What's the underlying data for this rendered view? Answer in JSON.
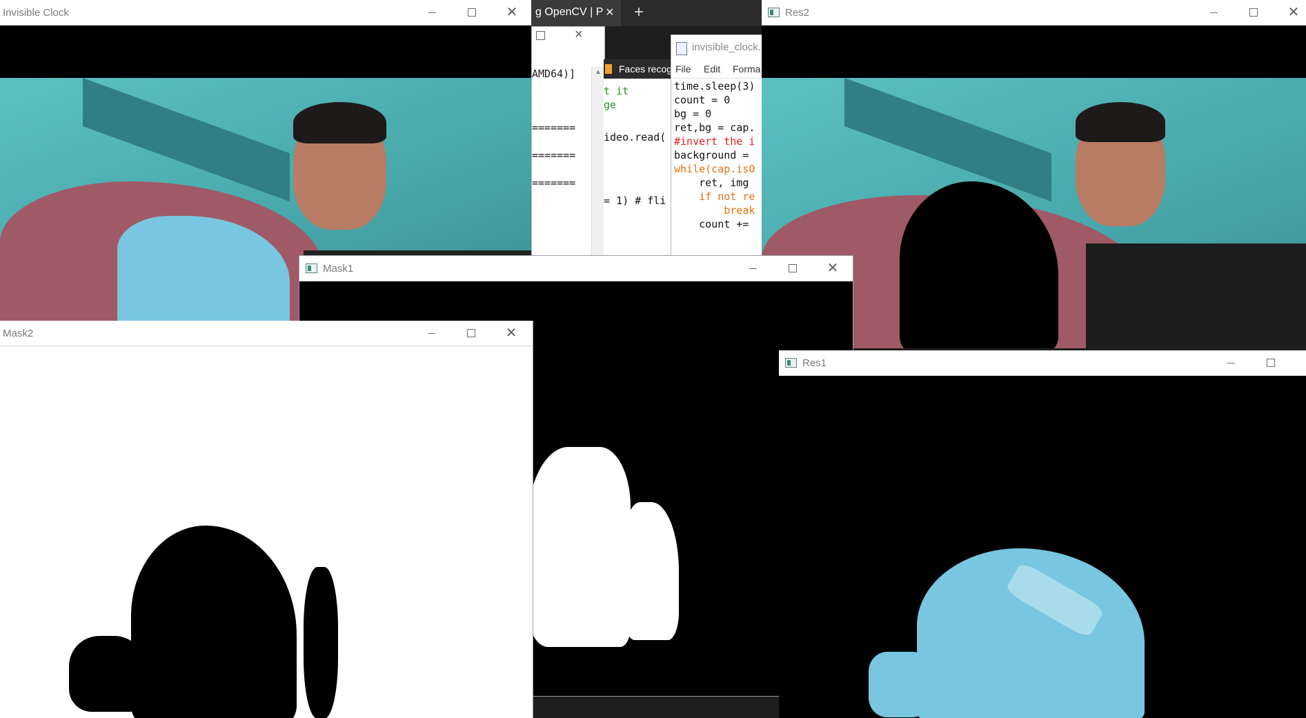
{
  "desktop": {
    "browser_tab_title": "g OpenCV | P",
    "browser_tab_close": "×",
    "browser_new_tab": "+",
    "bookmark_label": "Faces recog",
    "console_header": "AMD64)]",
    "console_lines": [
      "=======",
      "=======",
      "======="
    ],
    "python_fragments": [
      "t it",
      "ge",
      "ideo.read(",
      "= 1) # fli",
      "...."
    ],
    "editor": {
      "title": "invisible_clock.",
      "menu": [
        "File",
        "Edit",
        "Forma"
      ],
      "lines": [
        "time.sleep(3)",
        "count = 0",
        "bg = 0",
        "ret,bg = cap.",
        "",
        "#invert the i",
        "background =",
        "",
        "while(cap.isO",
        "    ret, img",
        "    if not re",
        "        break",
        "    count +="
      ]
    }
  },
  "windows": {
    "invisible_clock": {
      "title": "Invisible Clock"
    },
    "res2": {
      "title": "Res2"
    },
    "mask1": {
      "title": "Mask1"
    },
    "mask2": {
      "title": "Mask2"
    },
    "res1": {
      "title": "Res1"
    }
  },
  "colors": {
    "wall_teal": "#4fb2b4",
    "cloak_cyan": "#78c6df",
    "blanket_pink": "#a05a66",
    "skin": "#b77c63",
    "mask_white": "#ffffff",
    "mask_black": "#000000"
  }
}
